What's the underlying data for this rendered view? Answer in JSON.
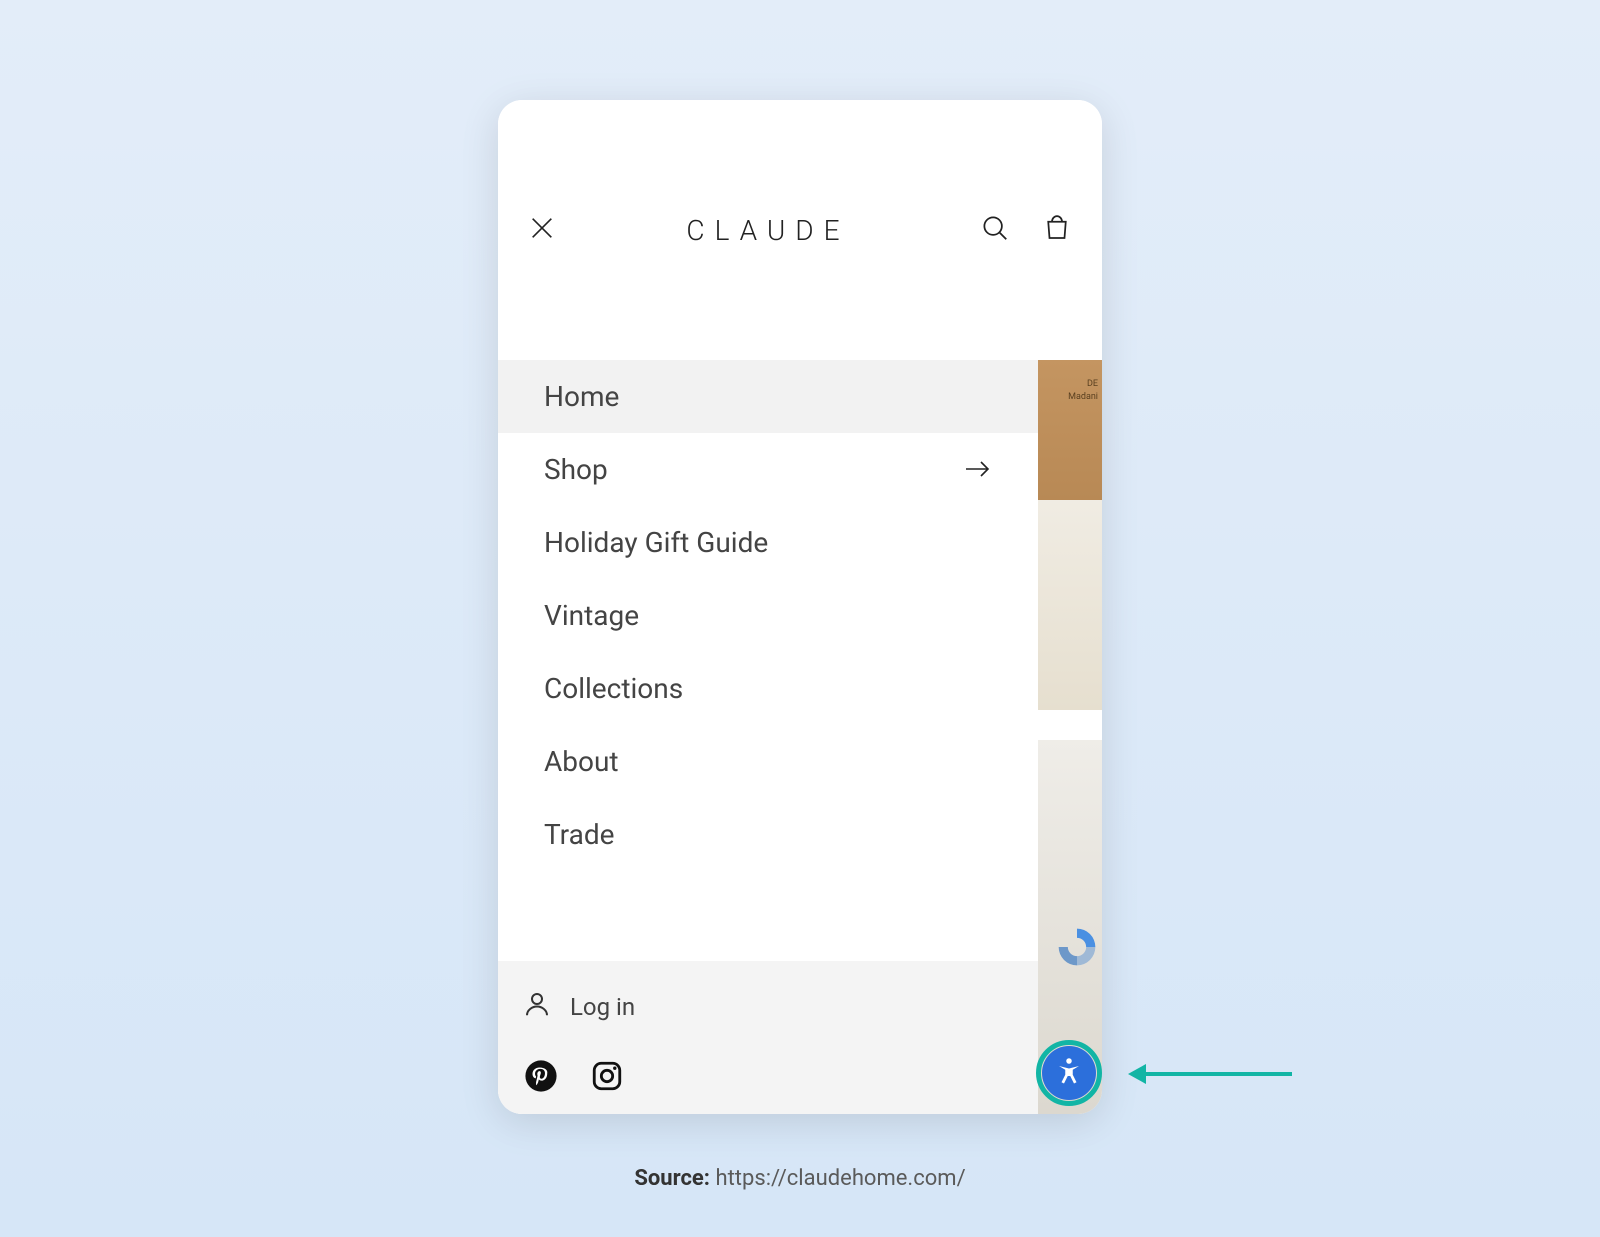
{
  "header": {
    "logo": "CLAUDE"
  },
  "menu": {
    "items": [
      {
        "label": "Home",
        "active": true,
        "has_arrow": false
      },
      {
        "label": "Shop",
        "active": false,
        "has_arrow": true
      },
      {
        "label": "Holiday Gift Guide",
        "active": false,
        "has_arrow": false
      },
      {
        "label": "Vintage",
        "active": false,
        "has_arrow": false
      },
      {
        "label": "Collections",
        "active": false,
        "has_arrow": false
      },
      {
        "label": "About",
        "active": false,
        "has_arrow": false
      },
      {
        "label": "Trade",
        "active": false,
        "has_arrow": false
      }
    ],
    "login_label": "Log in"
  },
  "background_peek": {
    "line1": "DE",
    "line2": "Madani"
  },
  "source": {
    "label": "Source:",
    "url": "https://claudehome.com/"
  },
  "colors": {
    "highlight": "#12b5a5",
    "accessibility_button": "#2c6fdb"
  }
}
